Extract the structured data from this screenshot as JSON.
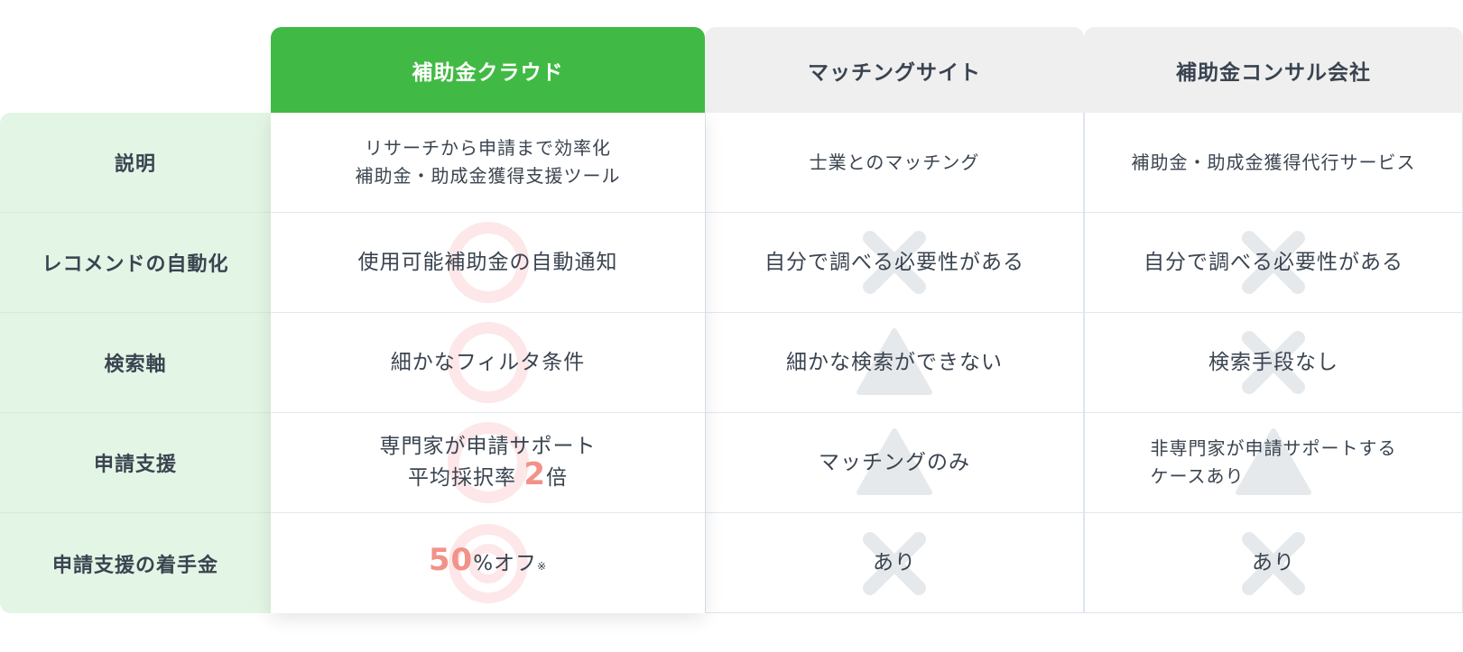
{
  "headers": {
    "col1": "補助金クラウド",
    "col2": "マッチングサイト",
    "col3": "補助金コンサル会社"
  },
  "rows": [
    {
      "label": "説明",
      "col1": {
        "line1": "リサーチから申請まで効率化",
        "line2": "補助金・助成金獲得支援ツール",
        "mark": "none"
      },
      "col2": {
        "text": "士業とのマッチング",
        "mark": "none"
      },
      "col3": {
        "text": "補助金・助成金獲得代行サービス",
        "mark": "none"
      }
    },
    {
      "label": "レコメンドの自動化",
      "col1": {
        "text": "使用可能補助金の自動通知",
        "mark": "circle"
      },
      "col2": {
        "text": "自分で調べる必要性がある",
        "mark": "cross"
      },
      "col3": {
        "text": "自分で調べる必要性がある",
        "mark": "cross"
      }
    },
    {
      "label": "検索軸",
      "col1": {
        "text": "細かなフィルタ条件",
        "mark": "circle"
      },
      "col2": {
        "text": "細かな検索ができない",
        "mark": "triangle"
      },
      "col3": {
        "text": "検索手段なし",
        "mark": "cross"
      }
    },
    {
      "label": "申請支援",
      "col1": {
        "line1": "専門家が申請サポート",
        "line2_prefix": "平均採択率",
        "line2_number": "2",
        "line2_suffix": "倍",
        "mark": "circle"
      },
      "col2": {
        "text": "マッチングのみ",
        "mark": "triangle"
      },
      "col3": {
        "line1": "非専門家が申請サポートする",
        "line2": "ケースあり",
        "mark": "triangle"
      }
    },
    {
      "label": "申請支援の着手金",
      "col1": {
        "number": "50",
        "suffix": "%オフ",
        "note": "※",
        "mark": "double-circle"
      },
      "col2": {
        "text": "あり",
        "mark": "cross"
      },
      "col3": {
        "text": "あり",
        "mark": "cross"
      }
    }
  ],
  "colors": {
    "primary": "#41ba45",
    "label_bg": "#e3f5e5",
    "header_other_bg": "#efefef",
    "mark_red": "#fde7e8",
    "mark_gray": "#e6e9ec",
    "accent_number": "#f29288",
    "text": "#3a4450"
  }
}
